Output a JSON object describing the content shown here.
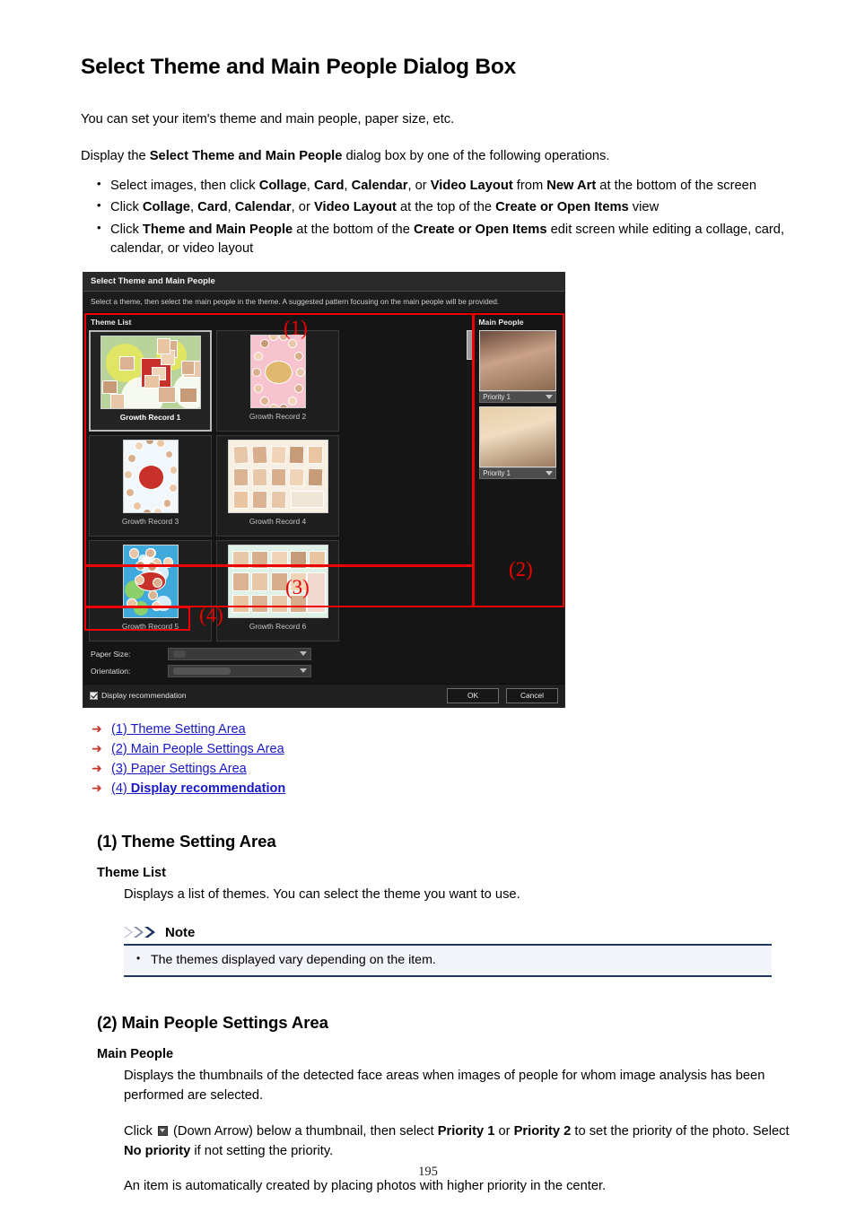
{
  "document": {
    "title": "Select Theme and Main People Dialog Box",
    "intro": "You can set your item's theme and main people, paper size, etc.",
    "display_line_pre": "Display the ",
    "display_line_bold": "Select Theme and Main People",
    "display_line_post": " dialog box by one of the following operations.",
    "page_number": "195"
  },
  "operations": [
    {
      "segments": [
        {
          "text": "Select images, then click ",
          "bold": false
        },
        {
          "text": "Collage",
          "bold": true
        },
        {
          "text": ", ",
          "bold": false
        },
        {
          "text": "Card",
          "bold": true
        },
        {
          "text": ", ",
          "bold": false
        },
        {
          "text": "Calendar",
          "bold": true
        },
        {
          "text": ", or ",
          "bold": false
        },
        {
          "text": "Video Layout",
          "bold": true
        },
        {
          "text": " from ",
          "bold": false
        },
        {
          "text": "New Art",
          "bold": true
        },
        {
          "text": " at the bottom of the screen",
          "bold": false
        }
      ]
    },
    {
      "segments": [
        {
          "text": "Click ",
          "bold": false
        },
        {
          "text": "Collage",
          "bold": true
        },
        {
          "text": ", ",
          "bold": false
        },
        {
          "text": "Card",
          "bold": true
        },
        {
          "text": ", ",
          "bold": false
        },
        {
          "text": "Calendar",
          "bold": true
        },
        {
          "text": ", or ",
          "bold": false
        },
        {
          "text": "Video Layout",
          "bold": true
        },
        {
          "text": " at the top of the ",
          "bold": false
        },
        {
          "text": "Create or Open Items",
          "bold": true
        },
        {
          "text": " view",
          "bold": false
        }
      ]
    },
    {
      "segments": [
        {
          "text": "Click ",
          "bold": false
        },
        {
          "text": "Theme and Main People",
          "bold": true
        },
        {
          "text": " at the bottom of the ",
          "bold": false
        },
        {
          "text": "Create or Open Items",
          "bold": true
        },
        {
          "text": " edit screen while editing a collage, card, calendar, or video layout",
          "bold": false
        }
      ]
    }
  ],
  "dialog": {
    "title": "Select Theme and Main People",
    "description": "Select a theme, then select the main people in the theme. A suggested pattern focusing on the main people will be provided.",
    "theme_list_label": "Theme List",
    "main_people_label": "Main People",
    "themes": [
      {
        "name": "Growth Record 1",
        "selected": true,
        "orientation": "landscape",
        "bg": "#b9d49a"
      },
      {
        "name": "Growth Record 2",
        "selected": false,
        "orientation": "portrait",
        "bg": "#f6c3ce"
      },
      {
        "name": "Growth Record 3",
        "selected": false,
        "orientation": "portrait",
        "bg": "#f2f7fb"
      },
      {
        "name": "Growth Record 4",
        "selected": false,
        "orientation": "landscape",
        "bg": "#f7efe2"
      },
      {
        "name": "Growth Record 5",
        "selected": false,
        "orientation": "portrait",
        "bg": "#3fa9dc"
      },
      {
        "name": "Growth Record 6",
        "selected": false,
        "orientation": "landscape",
        "bg": "#dff0e6"
      }
    ],
    "main_people": [
      {
        "priority": "Priority 1"
      },
      {
        "priority": "Priority 1"
      }
    ],
    "paper": {
      "size_label": "Paper Size:",
      "size_value": "",
      "orientation_label": "Orientation:",
      "orientation_value": ""
    },
    "display_recommendation_label": "Display recommendation",
    "display_recommendation_checked": true,
    "ok_label": "OK",
    "cancel_label": "Cancel",
    "callouts": [
      "(1)",
      "(2)",
      "(3)",
      "(4)"
    ],
    "callout_color": "#ee0000"
  },
  "links": [
    {
      "label": "(1) Theme Setting Area",
      "bold_part": ""
    },
    {
      "label": "(2) Main People Settings Area",
      "bold_part": ""
    },
    {
      "label": "(3) Paper Settings Area",
      "bold_part": ""
    },
    {
      "label_prefix": "(4) ",
      "bold_part": "Display recommendation",
      "label": "(4) Display recommendation"
    }
  ],
  "sections": [
    {
      "heading": "(1) Theme Setting Area",
      "sub_heading": "Theme List",
      "paragraph": "Displays a list of themes. You can select the theme you want to use."
    },
    {
      "heading": "(2) Main People Settings Area",
      "sub_heading": "Main People",
      "paragraph": "Displays the thumbnails of the detected face areas when images of people for whom image analysis has been performed are selected."
    }
  ],
  "note": {
    "label": "Note",
    "items": [
      "The themes displayed vary depending on the item."
    ]
  },
  "priority_paragraph": {
    "pre": "Click ",
    "icon": "down-arrow-icon",
    "mid1": " (Down Arrow) below a thumbnail, then select ",
    "b1": "Priority 1",
    "mid2": " or ",
    "b2": "Priority 2",
    "mid3": " to set the priority of the photo. Select ",
    "b3": "No priority",
    "post": " if not setting the priority."
  },
  "final_paragraph": "An item is automatically created by placing photos with higher priority in the center."
}
